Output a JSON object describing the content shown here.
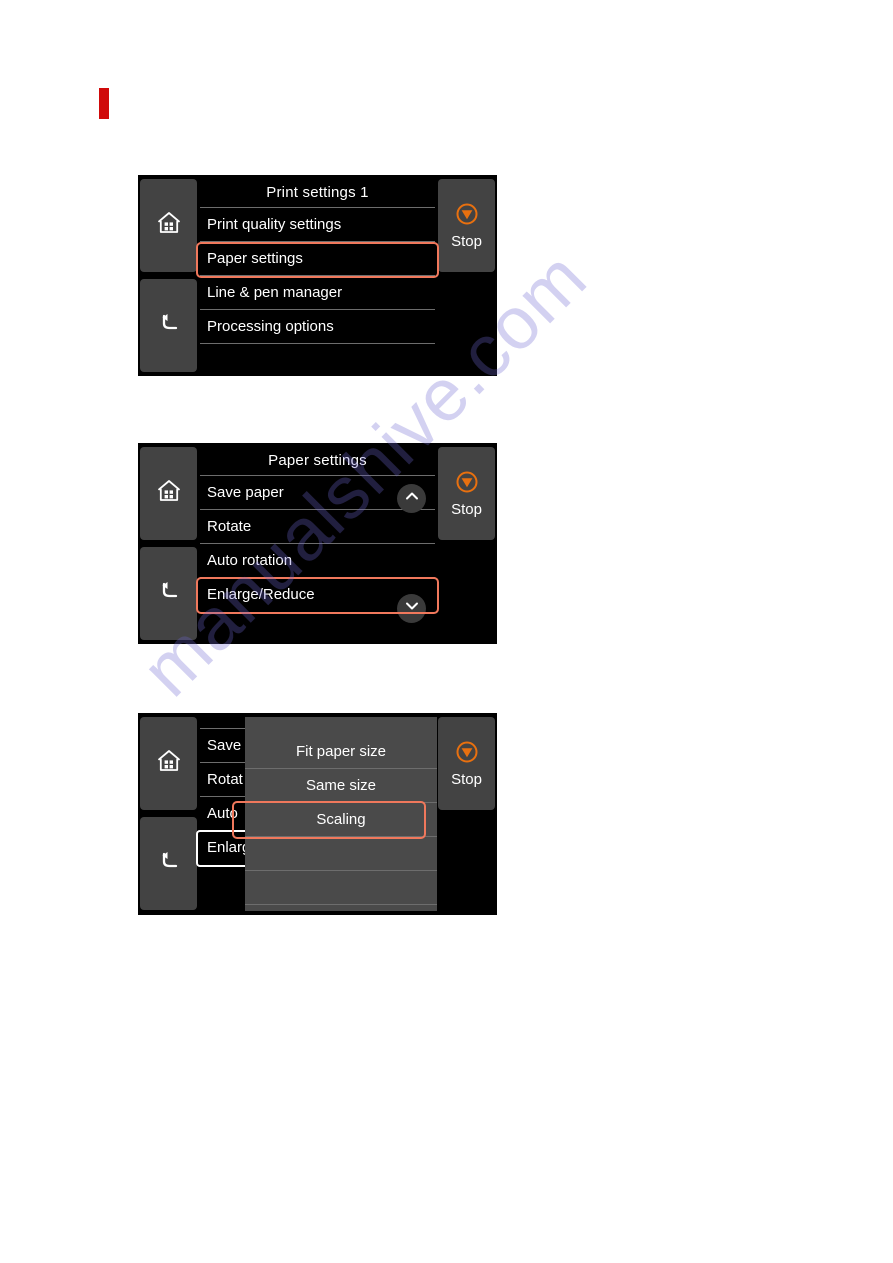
{
  "page": {
    "marker_color": "#d00a0a",
    "watermark": "manualshive.com",
    "watermark_color": "#6c66d2"
  },
  "accent": {
    "selection_outline": "#f0785c",
    "stop_icon": "#e8700f",
    "panel_background": "#000000",
    "key_background": "#434343",
    "popup_background": "#4a4a4a"
  },
  "panels": [
    {
      "id": "print-settings-1",
      "title": "Print settings 1",
      "left_keys": [
        {
          "name": "home-key",
          "icon": "home-icon",
          "label": ""
        },
        {
          "name": "back-key",
          "icon": "back-arrow-icon",
          "label": ""
        }
      ],
      "right_keys": [
        {
          "name": "stop-key",
          "icon": "stop-icon",
          "label": "Stop"
        }
      ],
      "items": [
        {
          "label": "Print quality settings",
          "selected": false,
          "chevron": ""
        },
        {
          "label": "Paper settings",
          "selected": true,
          "chevron": ""
        },
        {
          "label": "Line & pen manager",
          "selected": false,
          "chevron": ""
        },
        {
          "label": "Processing options",
          "selected": false,
          "chevron": ""
        }
      ]
    },
    {
      "id": "paper-settings",
      "title": "Paper settings",
      "left_keys": [
        {
          "name": "home-key",
          "icon": "home-icon",
          "label": ""
        },
        {
          "name": "back-key",
          "icon": "back-arrow-icon",
          "label": ""
        }
      ],
      "right_keys": [
        {
          "name": "stop-key",
          "icon": "stop-icon",
          "label": "Stop"
        }
      ],
      "items": [
        {
          "label": "Save paper",
          "selected": false,
          "chevron": "chevron-up-icon"
        },
        {
          "label": "Rotate",
          "selected": false,
          "chevron": ""
        },
        {
          "label": "Auto rotation",
          "selected": false,
          "chevron": ""
        },
        {
          "label": "Enlarge/Reduce",
          "selected": true,
          "chevron": "chevron-down-icon"
        }
      ]
    },
    {
      "id": "enlarge-reduce-popup",
      "title": "",
      "left_keys": [
        {
          "name": "home-key",
          "icon": "home-icon",
          "label": ""
        },
        {
          "name": "back-key",
          "icon": "back-arrow-icon",
          "label": ""
        }
      ],
      "right_keys": [
        {
          "name": "stop-key",
          "icon": "stop-icon",
          "label": "Stop"
        }
      ],
      "background_items": [
        {
          "label": "Save",
          "selected": false
        },
        {
          "label": "Rotat",
          "selected": false
        },
        {
          "label": "Auto",
          "selected": false
        },
        {
          "label": "Enlarg",
          "selected": true
        }
      ],
      "popup_items": [
        {
          "label": "Fit paper size",
          "selected": false
        },
        {
          "label": "Same size",
          "selected": false
        },
        {
          "label": "Scaling",
          "selected": true
        }
      ]
    }
  ]
}
